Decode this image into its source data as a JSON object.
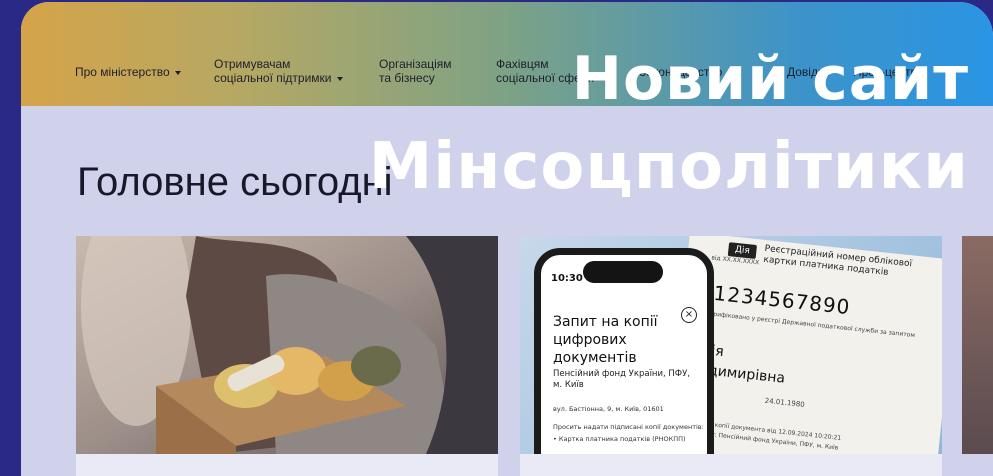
{
  "nav": {
    "items": [
      {
        "label": "Про міністерство",
        "dropdown": true
      },
      {
        "label_line1": "Отримувачам",
        "label_line2": "соціальної підтримки",
        "dropdown": true
      },
      {
        "label_line1": "Організаціям",
        "label_line2": "та бізнесу"
      },
      {
        "label_line1": "Фахівцям",
        "label_line2": "соціальної сфери"
      },
      {
        "label": "Законодавство",
        "dropdown": true
      },
      {
        "label": "Довідки"
      },
      {
        "label": "Прес-центр"
      }
    ]
  },
  "headline": {
    "line1": "Новий сайт",
    "line2": "Мінсоцполітики"
  },
  "section_title": "Головне сьогодні",
  "cards": {
    "phone": {
      "time": "10:30",
      "title": "Запит на копії цифрових документів",
      "org": "Пенсійний фонд України, ПФУ, м. Київ",
      "address": "вул. Бастіонна, 9, м. Київ, 01601",
      "ask": "Просить надати підписані копії документів:",
      "item": "• Картка платника податків (РНОКПП)"
    },
    "doc": {
      "logo": "Дія",
      "heading": "Реєстраційний номер облікової картки платника податків",
      "number": "1234567890",
      "verify": "Верифіковано у реєстрі Державної податкової служби за запитом",
      "code": "від ХХ.ХХ.ХХХХ",
      "name1": "дія",
      "name2": "одимирівна",
      "date": "24.01.1980",
      "footer1": "формі копії документа від 12.09.2024 10:20:21",
      "footer2": "запиту: Пенсійний фонд України, ПФУ, м. Київ"
    }
  },
  "colors": {
    "page_bg": "#2a2a86",
    "panel_bg": "#cfd2ea",
    "gradient_start": "#d5a449",
    "gradient_end": "#2a95e4",
    "headline": "#ffffff"
  }
}
